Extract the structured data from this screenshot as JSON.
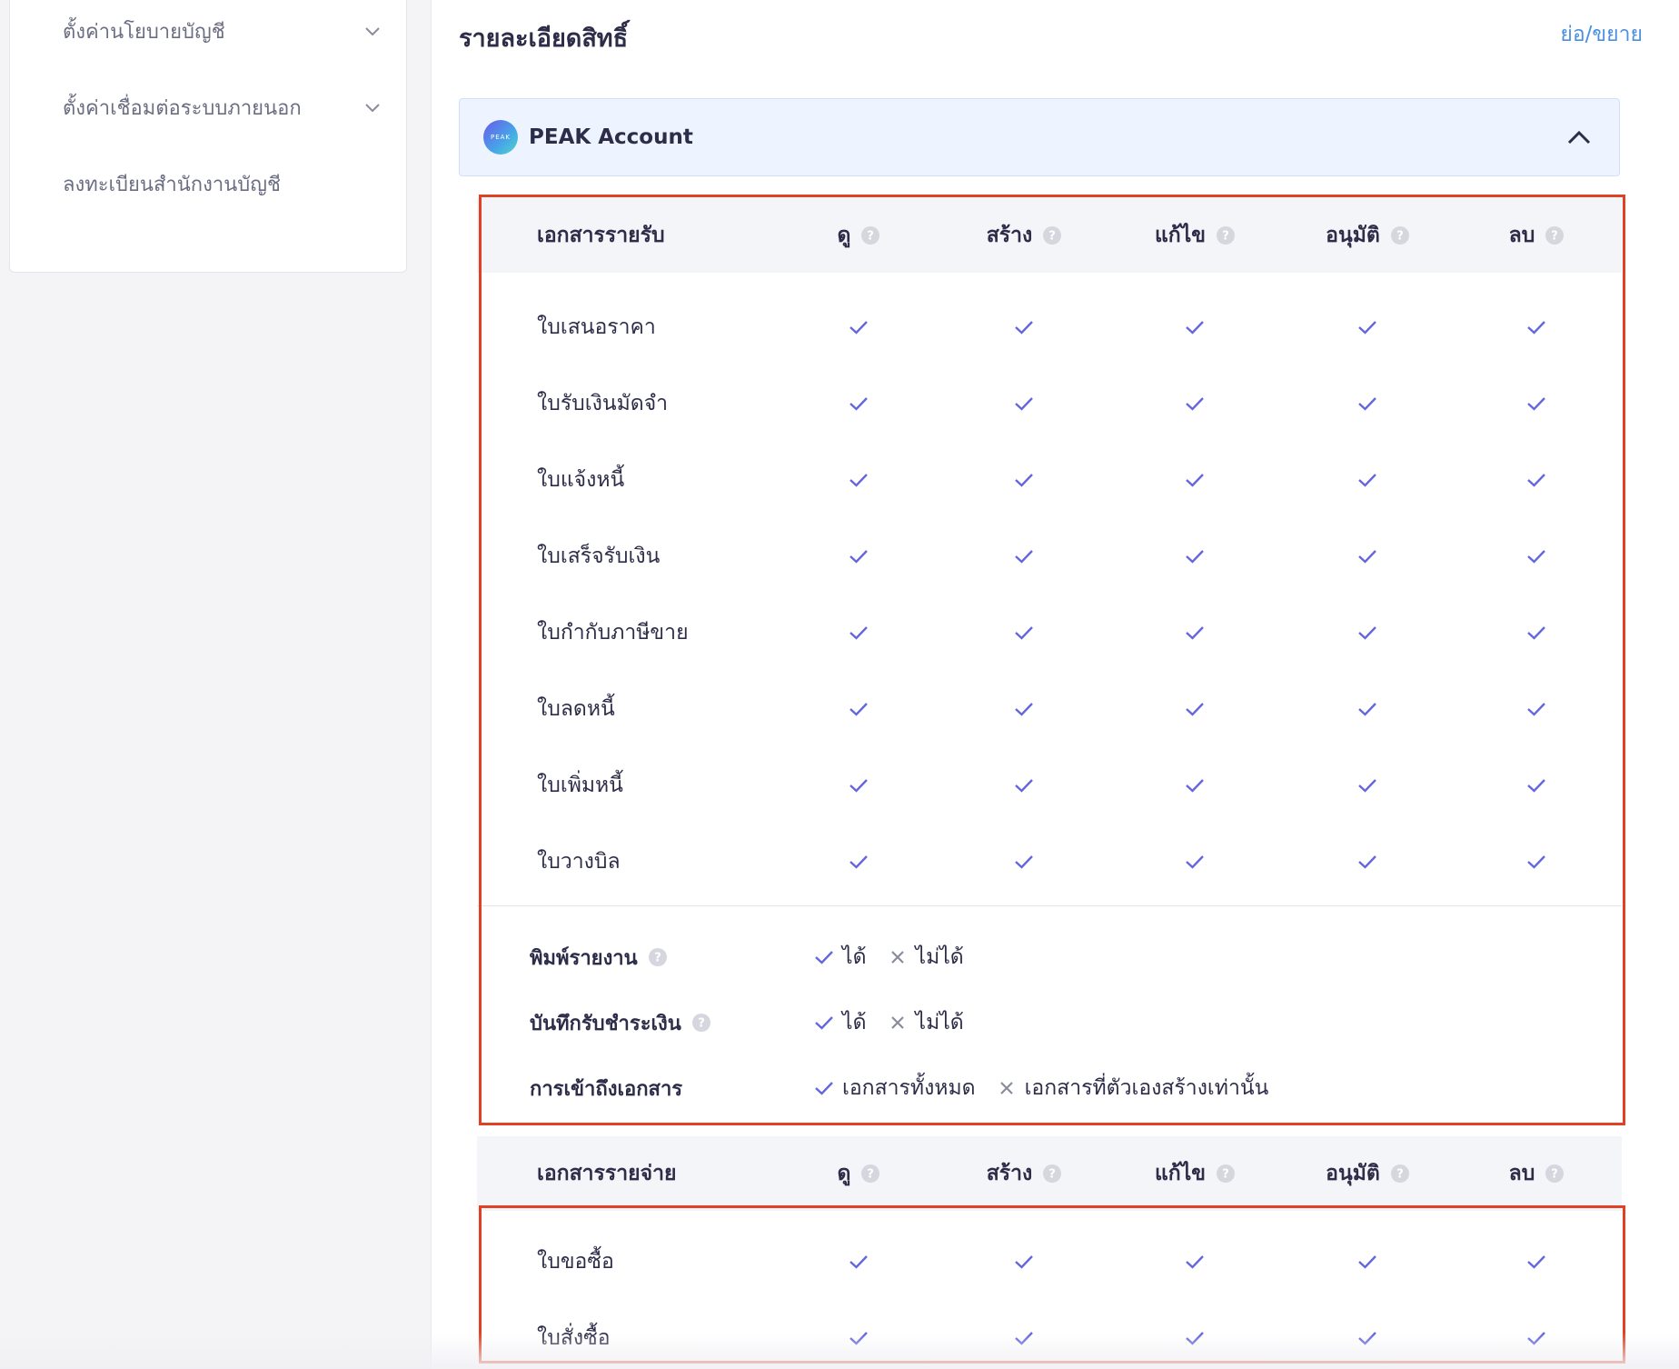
{
  "sidebar": {
    "items": [
      {
        "label": "ตั้งค่านโยบายบัญชี",
        "has_chevron": true
      },
      {
        "label": "ตั้งค่าเชื่อมต่อระบบภายนอก",
        "has_chevron": true
      },
      {
        "label": "ลงทะเบียนสำนักงานบัญชี",
        "has_chevron": false
      }
    ]
  },
  "main": {
    "title": "รายละเอียดสิทธิ์",
    "toggle_link": "ย่อ/ขยาย",
    "account": {
      "logo_text": "PEAK",
      "name": "PEAK Account",
      "expanded": true
    },
    "columns": [
      "ดู",
      "สร้าง",
      "แก้ไข",
      "อนุมัติ",
      "ลบ"
    ],
    "revenue_section": {
      "title": "เอกสารรายรับ",
      "rows": [
        {
          "label": "ใบเสนอราคา",
          "perms": [
            true,
            true,
            true,
            true,
            true
          ]
        },
        {
          "label": "ใบรับเงินมัดจำ",
          "perms": [
            true,
            true,
            true,
            true,
            true
          ]
        },
        {
          "label": "ใบแจ้งหนี้",
          "perms": [
            true,
            true,
            true,
            true,
            true
          ]
        },
        {
          "label": "ใบเสร็จรับเงิน",
          "perms": [
            true,
            true,
            true,
            true,
            true
          ]
        },
        {
          "label": "ใบกำกับภาษีขาย",
          "perms": [
            true,
            true,
            true,
            true,
            true
          ]
        },
        {
          "label": "ใบลดหนี้",
          "perms": [
            true,
            true,
            true,
            true,
            true
          ]
        },
        {
          "label": "ใบเพิ่มหนี้",
          "perms": [
            true,
            true,
            true,
            true,
            true
          ]
        },
        {
          "label": "ใบวางบิล",
          "perms": [
            true,
            true,
            true,
            true,
            true
          ]
        }
      ],
      "options": [
        {
          "label": "พิมพ์รายงาน",
          "has_help": true,
          "choices": [
            {
              "label": "ได้",
              "state": "check"
            },
            {
              "label": "ไม่ได้",
              "state": "cross"
            }
          ]
        },
        {
          "label": "บันทึกรับชำระเงิน",
          "has_help": true,
          "choices": [
            {
              "label": "ได้",
              "state": "check"
            },
            {
              "label": "ไม่ได้",
              "state": "cross"
            }
          ]
        },
        {
          "label": "การเข้าถึงเอกสาร",
          "has_help": false,
          "choices": [
            {
              "label": "เอกสารทั้งหมด",
              "state": "check"
            },
            {
              "label": "เอกสารที่ตัวเองสร้างเท่านั้น",
              "state": "cross"
            }
          ]
        }
      ]
    },
    "expense_section": {
      "title": "เอกสารรายจ่าย",
      "rows": [
        {
          "label": "ใบขอซื้อ",
          "perms": [
            true,
            true,
            true,
            true,
            true
          ]
        },
        {
          "label": "ใบสั่งซื้อ",
          "perms": [
            true,
            true,
            true,
            true,
            true
          ]
        }
      ]
    }
  },
  "colors": {
    "check": "#6466e0",
    "cross": "#8a8c9c",
    "highlight": "#e04124",
    "link": "#4a8fe0",
    "account_header_bg": "#edf4ff"
  }
}
